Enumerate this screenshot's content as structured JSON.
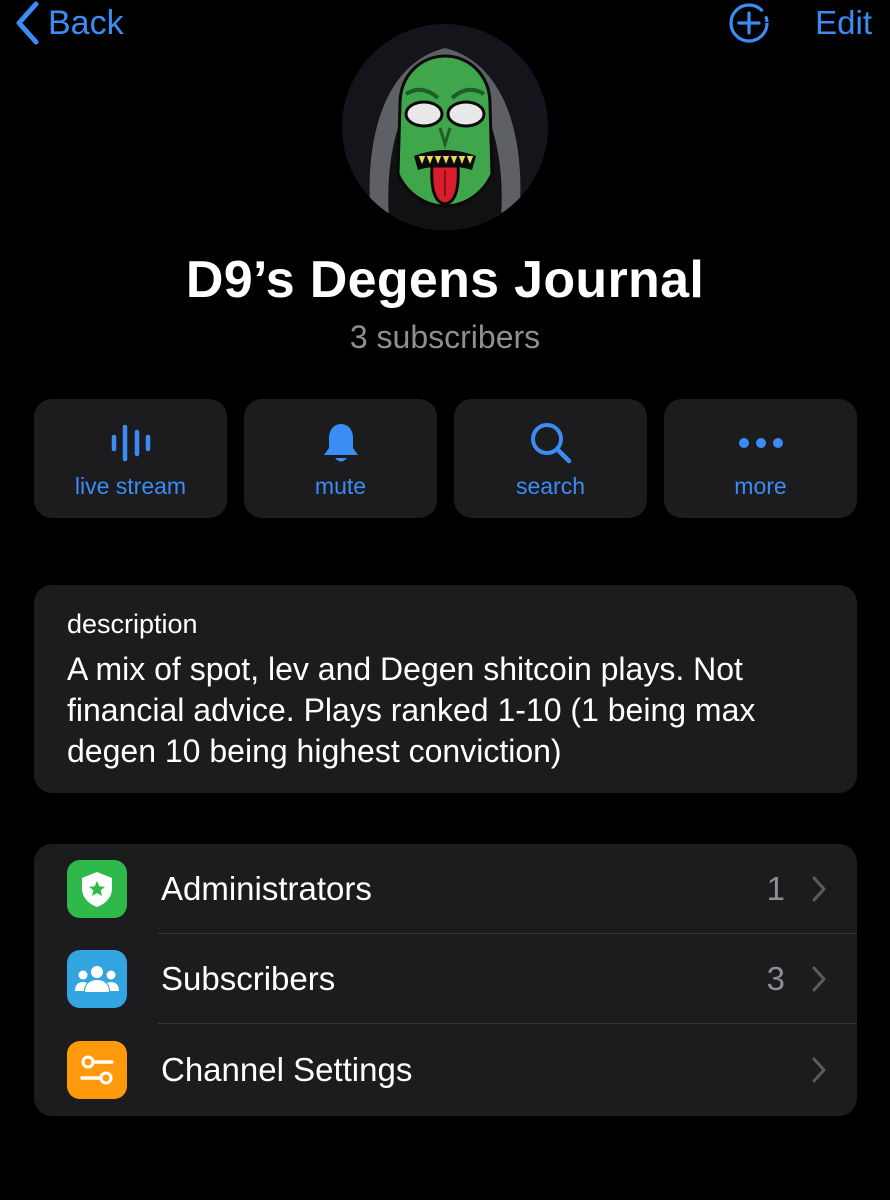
{
  "nav": {
    "back_label": "Back",
    "add_icon": "add-circle-icon",
    "edit_label": "Edit",
    "accent_color": "#3b8cf5"
  },
  "channel": {
    "title": "D9’s Degens Journal",
    "subtitle": "3 subscribers",
    "avatar": "green-monster-avatar"
  },
  "actions": [
    {
      "label": "live stream",
      "icon": "live-stream-icon"
    },
    {
      "label": "mute",
      "icon": "bell-icon"
    },
    {
      "label": "search",
      "icon": "search-icon"
    },
    {
      "label": "more",
      "icon": "more-icon"
    }
  ],
  "description": {
    "label": "description",
    "text": "A mix of spot, lev and Degen shitcoin plays. Not financial advice. Plays ranked 1-10 (1 being max degen 10 being highest conviction)"
  },
  "list": [
    {
      "label": "Administrators",
      "count": "1",
      "icon": "shield-star-icon",
      "icon_color": "#30b94b"
    },
    {
      "label": "Subscribers",
      "count": "3",
      "icon": "people-icon",
      "icon_color": "#32a4e0"
    },
    {
      "label": "Channel Settings",
      "count": "",
      "icon": "sliders-icon",
      "icon_color": "#ff9b0a"
    }
  ]
}
